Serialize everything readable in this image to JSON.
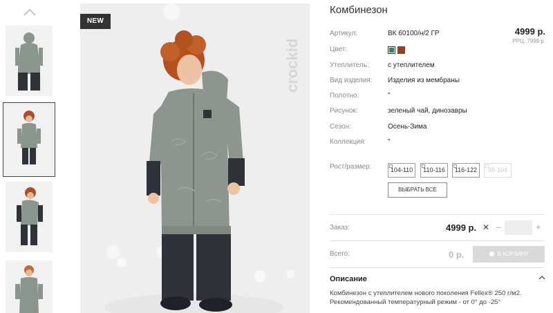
{
  "product": {
    "badge": "NEW",
    "title": "Комбинезон",
    "price": "4999 р.",
    "rrp": "РРЦ: 7999 р.",
    "brand": "crockid"
  },
  "attributes": {
    "article_label": "Артикул:",
    "article_value": "ВК 60100/н/2 ГР",
    "color_label": "Цвет:",
    "color_swatches": [
      "#2e8b4a",
      "#9a3e1c"
    ],
    "insulation_label": "Утеплитель:",
    "insulation_value": "с утеплителем",
    "type_label": "Вид изделия:",
    "type_value": "Изделия из мембраны",
    "fabric_label": "Полотно:",
    "fabric_value": "\"",
    "pattern_label": "Рисунок:",
    "pattern_value": "зеленый чай, динозавры",
    "season_label": "Сезон:",
    "season_value": "Осень-Зима",
    "collection_label": "Коллекция:",
    "collection_value": "\""
  },
  "sizes": {
    "label": "Рост/размер:",
    "options": [
      "104-110",
      "110-116",
      "116-122",
      "98-104"
    ],
    "disabled_index": 3,
    "select_all": "ВЫБРАТЬ ВСЕ"
  },
  "order": {
    "label": "Заказ:",
    "price": "4999 р.",
    "times": "✕",
    "minus": "–",
    "plus": "+",
    "qty": ""
  },
  "total": {
    "label": "Всего:",
    "value": "0 р.",
    "cart_button": "В КОРЗИНУ"
  },
  "description": {
    "title": "Описание",
    "text": "Комбинезон с утеплителем нового поколения Fellex® 250 г/м2. Рекомендованный температурный режим - от 0° до -25°"
  },
  "icons": {
    "thumbs_up": "chevron-up-icon",
    "desc_toggle": "chevron-up-icon",
    "cart": "cart-icon"
  }
}
